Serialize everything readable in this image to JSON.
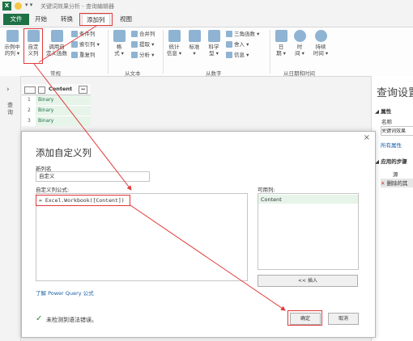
{
  "title_bar": {
    "text": "关键词效果分析 - 查询编辑器",
    "icon": "excel-icon"
  },
  "menu": {
    "file": "文件",
    "home": "开始",
    "transform": "转换",
    "add_column": "添加列",
    "view": "视图"
  },
  "ribbon": {
    "col_from_examples": "示例中\n的列 ▾",
    "custom_column": "自定\n义列",
    "invoke_function": "调用自\n定义函数",
    "conditional_column": "条件列",
    "index_column": "索引列 ▾",
    "duplicate_column": "重复列",
    "format": "格\n式 ▾",
    "merge_columns": "合并列",
    "extract": "提取 ▾",
    "parse": "分析 ▾",
    "statistics": "统计\n信息 ▾",
    "standard": "标准\n▾",
    "scientific": "科学\n型 ▾",
    "trigonometry": "三角函数 ▾",
    "rounding": "舍入 ▾",
    "information": "信息 ▾",
    "date": "日\n期 ▾",
    "time": "时\n间 ▾",
    "duration": "持续\n时间 ▾",
    "group_general": "常规",
    "group_from_text": "从文本",
    "group_from_number": "从数字",
    "group_from_datetime": "从日期和时间"
  },
  "sidebar_label": "查询",
  "grid": {
    "header": "Content",
    "rows": [
      {
        "num": "1",
        "val": "Binary"
      },
      {
        "num": "2",
        "val": "Binary"
      },
      {
        "num": "3",
        "val": "Binary"
      }
    ]
  },
  "right_pane": {
    "title": "查询设置",
    "properties": "属性",
    "name_label": "名称",
    "name_value": "关键词效果",
    "all_properties": "所有属性",
    "applied_steps": "应用的步骤",
    "step1": "源",
    "step2": "删除的其"
  },
  "dialog": {
    "title": "添加自定义列",
    "new_column_label": "新列名",
    "new_column_value": "自定义",
    "formula_label": "自定义列公式:",
    "formula_value": "= Excel.Workbook([Content])",
    "available_label": "可用列:",
    "available_item": "Content",
    "insert_button": "<< 插入",
    "learn_link": "了解 Power Query 公式",
    "status": "未检测到语法错误。",
    "ok": "确定",
    "cancel": "取消",
    "close": "×"
  },
  "colors": {
    "excel_green": "#1e7145",
    "highlight_red": "#e03a3a",
    "check_green": "#2b8a3e"
  }
}
